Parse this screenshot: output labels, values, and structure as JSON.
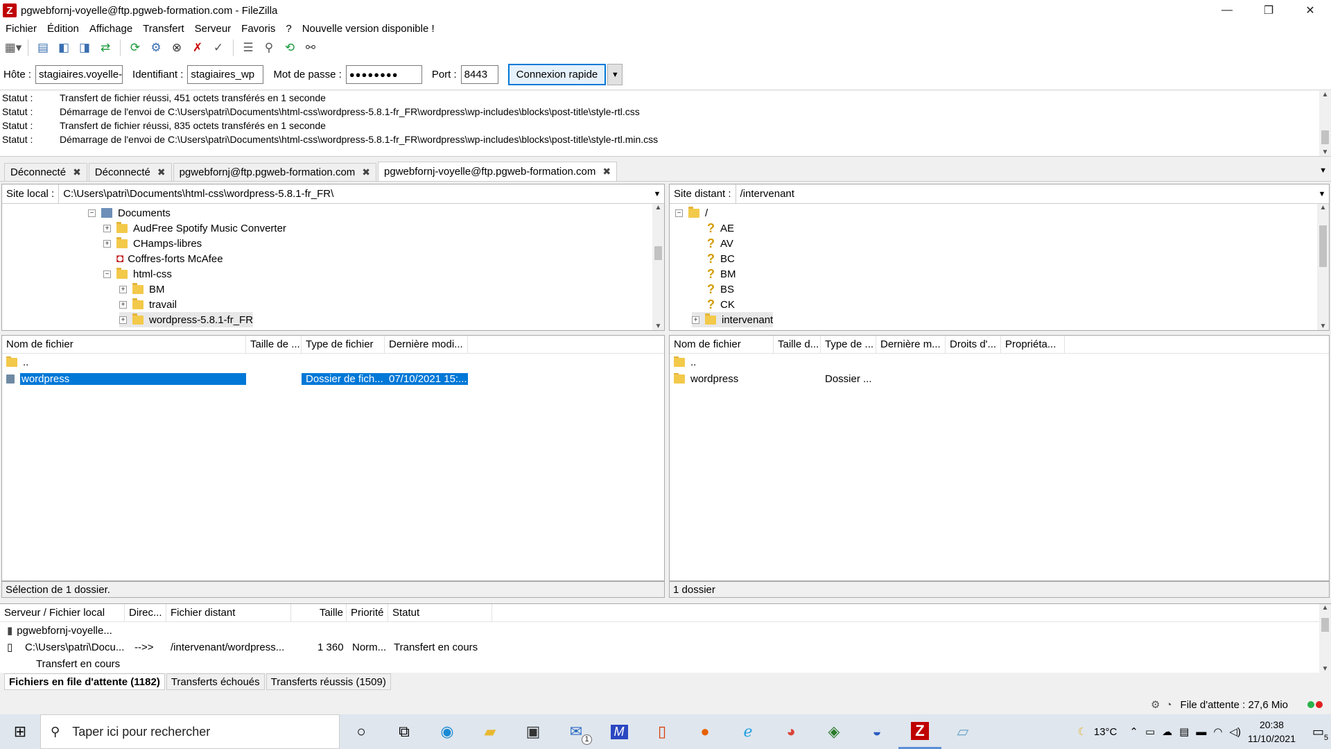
{
  "window": {
    "title": "pgwebfornj-voyelle@ftp.pgweb-formation.com - FileZilla",
    "app_icon_letter": "Z",
    "controls": {
      "minimize": "—",
      "maximize": "❐",
      "close": "✕"
    }
  },
  "menu": [
    "Fichier",
    "Édition",
    "Affichage",
    "Transfert",
    "Serveur",
    "Favoris",
    "?",
    "Nouvelle version disponible !"
  ],
  "toolbar": {
    "icons": [
      "site-manager-icon",
      "toggle-log-icon",
      "toggle-local-tree-icon",
      "toggle-remote-tree-icon",
      "toggle-queue-icon",
      "refresh-icon",
      "process-queue-icon",
      "cancel-icon",
      "disconnect-icon",
      "reconnect-icon",
      "directory-filter-icon",
      "compare-icon",
      "sync-browse-icon",
      "search-icon"
    ]
  },
  "quickconnect": {
    "host_label": "Hôte :",
    "host_value": "stagiaires.voyelle-",
    "user_label": "Identifiant :",
    "user_value": "stagiaires_wp",
    "pass_label": "Mot de passe :",
    "pass_value": "●●●●●●●●",
    "port_label": "Port :",
    "port_value": "8443",
    "connect_button": "Connexion rapide",
    "dropdown": "▼"
  },
  "log": [
    {
      "status": "Statut :",
      "message": "Transfert de fichier réussi, 451 octets transférés en 1 seconde"
    },
    {
      "status": "Statut :",
      "message": "Démarrage de l'envoi de C:\\Users\\patri\\Documents\\html-css\\wordpress-5.8.1-fr_FR\\wordpress\\wp-includes\\blocks\\post-title\\style-rtl.css"
    },
    {
      "status": "Statut :",
      "message": "Transfert de fichier réussi, 835 octets transférés en 1 seconde"
    },
    {
      "status": "Statut :",
      "message": "Démarrage de l'envoi de C:\\Users\\patri\\Documents\\html-css\\wordpress-5.8.1-fr_FR\\wordpress\\wp-includes\\blocks\\post-title\\style-rtl.min.css"
    }
  ],
  "tabs": [
    {
      "label": "Déconnecté",
      "close": "✖"
    },
    {
      "label": "Déconnecté",
      "close": "✖"
    },
    {
      "label": "pgwebfornj@ftp.pgweb-formation.com",
      "close": "✖"
    },
    {
      "label": "pgwebfornj-voyelle@ftp.pgweb-formation.com",
      "close": "✖"
    }
  ],
  "local": {
    "site_label": "Site local :",
    "path": "C:\\Users\\patri\\Documents\\html-css\\wordpress-5.8.1-fr_FR\\",
    "tree": [
      "Documents",
      "AudFree Spotify Music Converter",
      "CHamps-libres",
      "Coffres-forts McAfee",
      "html-css",
      "BM",
      "travail",
      "wordpress-5.8.1-fr_FR"
    ],
    "columns": [
      "Nom de fichier",
      "Taille de ...",
      "Type de fichier",
      "Dernière modi..."
    ],
    "files": [
      {
        "name": "..",
        "size": "",
        "type": "",
        "modified": ""
      },
      {
        "name": "wordpress",
        "size": "",
        "type": "Dossier de fich...",
        "modified": "07/10/2021 15:..."
      }
    ],
    "status": "Sélection de 1 dossier."
  },
  "remote": {
    "site_label": "Site distant :",
    "path": "/intervenant",
    "tree": [
      "/",
      "AE",
      "AV",
      "BC",
      "BM",
      "BS",
      "CK",
      "intervenant"
    ],
    "columns": [
      "Nom de fichier",
      "Taille d...",
      "Type de ...",
      "Dernière m...",
      "Droits d'...",
      "Propriéta..."
    ],
    "files": [
      {
        "name": "..",
        "type": ""
      },
      {
        "name": "wordpress",
        "type": "Dossier ..."
      }
    ],
    "status": "1 dossier"
  },
  "queue": {
    "columns": [
      "Serveur / Fichier local",
      "Direc...",
      "Fichier distant",
      "Taille",
      "Priorité",
      "Statut"
    ],
    "server": "pgwebfornj-voyelle...",
    "row": {
      "local": "C:\\Users\\patri\\Docu...",
      "direction": "-->>",
      "remote": "/intervenant/wordpress...",
      "size": "1 360",
      "priority": "Norm...",
      "status": "Transfert en cours"
    },
    "sub_status": "Transfert en cours",
    "tabs": [
      "Fichiers en file d'attente (1182)",
      "Transferts échoués",
      "Transferts réussis (1509)"
    ]
  },
  "statusbar": {
    "queue_text": "File d'attente : 27,6 Mio"
  },
  "taskbar": {
    "search_placeholder": "Taper ici pour rechercher",
    "apps": [
      "cortana-icon",
      "task-view-icon",
      "edge-icon",
      "file-explorer-icon",
      "store-icon",
      "mail-icon",
      "visual-studio-icon",
      "office-icon",
      "firefox-icon",
      "internet-explorer-icon",
      "chrome-icon",
      "app-icon",
      "thunderbird-icon",
      "filezilla-icon",
      "notepad-icon"
    ],
    "mail_badge": "1",
    "weather": "13°C",
    "time": "20:38",
    "date": "11/10/2021",
    "notifications": "5"
  },
  "colors": {
    "selection": "#0078d7",
    "filezilla_red": "#bf0000",
    "folder": "#f3c94a"
  }
}
